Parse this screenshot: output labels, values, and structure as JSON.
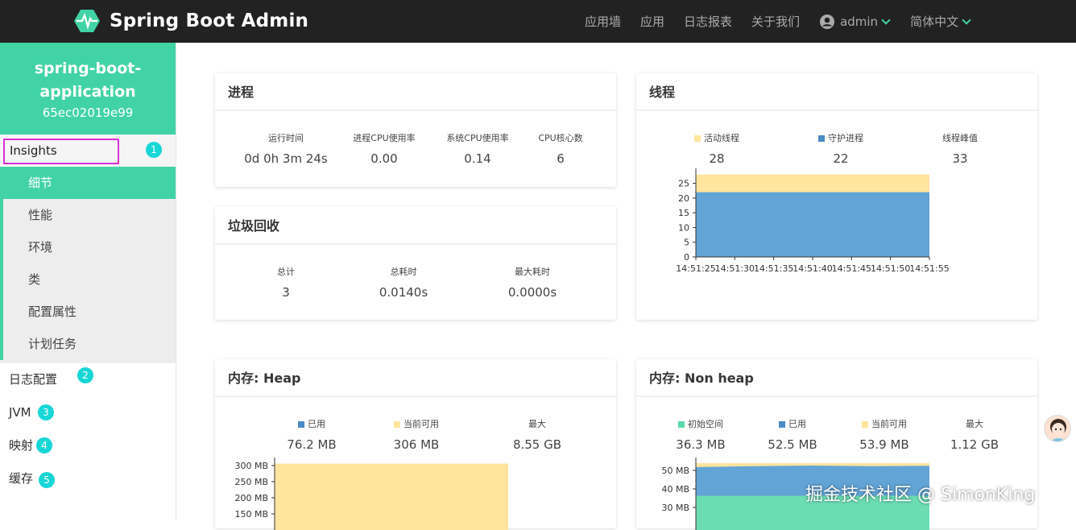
{
  "header": {
    "brand": "Spring Boot Admin",
    "nav": [
      "应用墙",
      "应用",
      "日志报表",
      "关于我们"
    ],
    "user": "admin",
    "language": "简体中文",
    "accent": "#42d3a5"
  },
  "sidebar": {
    "app_name_line1": "spring-boot-",
    "app_name_line2": "application",
    "app_id": "65ec02019e99",
    "insights": {
      "label": "Insights",
      "badge": "1"
    },
    "insight_items": [
      "细节",
      "性能",
      "环境",
      "类",
      "配置属性",
      "计划任务"
    ],
    "main_items": [
      {
        "label": "日志配置",
        "badge": "2"
      },
      {
        "label": "JVM",
        "badge": "3"
      },
      {
        "label": "映射",
        "badge": "4"
      },
      {
        "label": "缓存",
        "badge": "5"
      }
    ]
  },
  "process": {
    "title": "进程",
    "stats": [
      {
        "label": "运行时间",
        "value": "0d 0h 3m 24s"
      },
      {
        "label": "进程CPU使用率",
        "value": "0.00"
      },
      {
        "label": "系统CPU使用率",
        "value": "0.14"
      },
      {
        "label": "CPU核心数",
        "value": "6"
      }
    ]
  },
  "gc": {
    "title": "垃圾回收",
    "stats": [
      {
        "label": "总计",
        "value": "3"
      },
      {
        "label": "总耗时",
        "value": "0.0140s"
      },
      {
        "label": "最大耗时",
        "value": "0.0000s"
      }
    ]
  },
  "threads": {
    "title": "线程",
    "stats": [
      {
        "label": "活动线程",
        "value": "28",
        "color": "#ffe59e"
      },
      {
        "label": "守护进程",
        "value": "22",
        "color": "#4a8cc8"
      },
      {
        "label": "线程峰值",
        "value": "33"
      }
    ]
  },
  "heap": {
    "title": "内存: Heap",
    "stats": [
      {
        "label": "已用",
        "value": "76.2 MB",
        "color": "#4a8cc8"
      },
      {
        "label": "当前可用",
        "value": "306 MB",
        "color": "#ffe59e"
      },
      {
        "label": "最大",
        "value": "8.55 GB"
      }
    ]
  },
  "nonheap": {
    "title": "内存: Non heap",
    "stats": [
      {
        "label": "初始空间",
        "value": "36.3 MB",
        "color": "#5ed9a9"
      },
      {
        "label": "已用",
        "value": "52.5 MB",
        "color": "#4a8cc8"
      },
      {
        "label": "当前可用",
        "value": "53.9 MB",
        "color": "#ffe59e"
      },
      {
        "label": "最大",
        "value": "1.12 GB"
      }
    ]
  },
  "chart_data": [
    {
      "type": "area",
      "x": [
        "14:51:25",
        "14:51:30",
        "14:51:35",
        "14:51:40",
        "14:51:45",
        "14:51:50",
        "14:51:55"
      ],
      "series": [
        {
          "name": "守护进程",
          "values": [
            22,
            22,
            22,
            22,
            22,
            22,
            22
          ],
          "color": "#62a4d6"
        },
        {
          "name": "活动线程",
          "values": [
            28,
            28,
            28,
            28,
            28,
            28,
            28
          ],
          "color": "#ffe59e"
        }
      ],
      "yticks": [
        0,
        5,
        10,
        15,
        20,
        25
      ],
      "ylim": [
        0,
        29
      ]
    },
    {
      "type": "area",
      "yticks_labels": [
        "300 MB",
        "250 MB",
        "200 MB",
        "150 MB"
      ],
      "yticks": [
        300,
        250,
        200,
        150
      ],
      "series": [
        {
          "name": "当前可用",
          "values": [
            306,
            306
          ],
          "color": "#ffe59e"
        }
      ]
    },
    {
      "type": "area",
      "yticks_labels": [
        "50 MB",
        "40 MB",
        "30 MB"
      ],
      "yticks": [
        50,
        40,
        30
      ],
      "series": [
        {
          "name": "初始空间",
          "values": [
            36.3,
            36.3,
            36.3,
            36.3,
            36.3
          ],
          "color": "#6bdcb3"
        },
        {
          "name": "已用",
          "values": [
            51.8,
            52.3,
            52.6,
            52.3,
            52.5
          ],
          "color": "#62a4d6"
        },
        {
          "name": "当前可用",
          "values": [
            53.9,
            53.9,
            53.9,
            53.9,
            53.9
          ],
          "color": "#ffe59e"
        }
      ]
    }
  ],
  "watermark": "掘金技术社区 @ SimonKing"
}
